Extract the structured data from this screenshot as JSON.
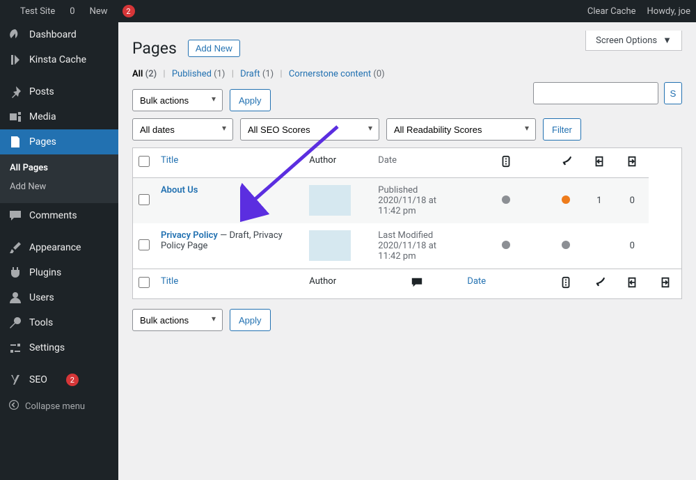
{
  "toolbar": {
    "site_name": "Test Site",
    "comments_count": "0",
    "new_label": "New",
    "yoast_count": "2",
    "clear_cache": "Clear Cache",
    "howdy": "Howdy, joe"
  },
  "sidebar": {
    "dashboard": "Dashboard",
    "kinsta": "Kinsta Cache",
    "posts": "Posts",
    "media": "Media",
    "pages": "Pages",
    "all_pages": "All Pages",
    "add_new": "Add New",
    "comments": "Comments",
    "appearance": "Appearance",
    "plugins": "Plugins",
    "users": "Users",
    "tools": "Tools",
    "settings": "Settings",
    "seo": "SEO",
    "seo_count": "2",
    "collapse": "Collapse menu"
  },
  "screen_options": "Screen Options",
  "heading": {
    "title": "Pages",
    "add_new": "Add New"
  },
  "views": {
    "all": "All",
    "all_count": "(2)",
    "published": "Published",
    "published_count": "(1)",
    "draft": "Draft",
    "draft_count": "(1)",
    "cornerstone": "Cornerstone content",
    "cornerstone_count": "(0)"
  },
  "filters": {
    "bulk": "Bulk actions",
    "apply": "Apply",
    "dates": "All dates",
    "seo": "All SEO Scores",
    "readability": "All Readability Scores",
    "filter": "Filter"
  },
  "search_button": "Search",
  "table": {
    "th_title": "Title",
    "th_author": "Author",
    "th_date": "Date"
  },
  "rows": [
    {
      "title": "About Us",
      "status": "Published",
      "date": "2020/11/18 at 11:42 pm",
      "seo_dot": "gray",
      "read_dot": "orange",
      "incoming": "1",
      "outgoing": "0",
      "meta": ""
    },
    {
      "title": "Privacy Policy",
      "meta": " — Draft, Privacy Policy Page",
      "status": "Last Modified",
      "date": "2020/11/18 at 11:42 pm",
      "seo_dot": "gray",
      "read_dot": "gray",
      "incoming": "",
      "outgoing": "0"
    }
  ]
}
